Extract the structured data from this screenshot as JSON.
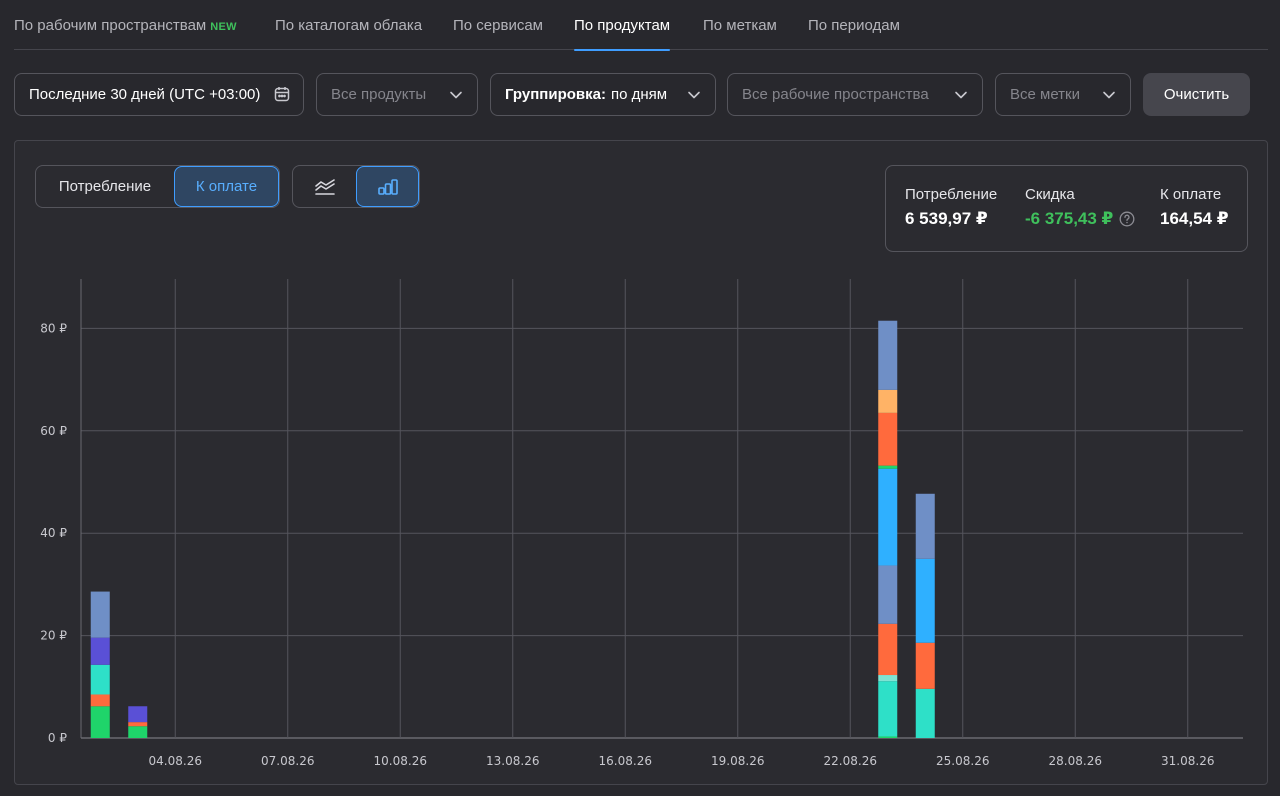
{
  "tabs": [
    {
      "label": "По рабочим пространствам",
      "badge": "NEW"
    },
    {
      "label": "По каталогам облака"
    },
    {
      "label": "По сервисам"
    },
    {
      "label": "По продуктам",
      "active": true
    },
    {
      "label": "По меткам"
    },
    {
      "label": "По периодам"
    }
  ],
  "filters": {
    "period": "Последние 30 дней (UTC +03:00)",
    "products_placeholder": "Все продукты",
    "grouping_label": "Группировка:",
    "grouping_value": "по дням",
    "workspaces_placeholder": "Все рабочие пространства",
    "labels_placeholder": "Все метки",
    "clear_label": "Очистить"
  },
  "mode": {
    "consumption_label": "Потребление",
    "payable_label": "К оплате",
    "selected": "К оплате",
    "chart_view": "bar"
  },
  "summary": {
    "consumption_label": "Потребление",
    "consumption_value": "6 539,97 ₽",
    "discount_label": "Скидка",
    "discount_value": "-6 375,43 ₽",
    "payable_label": "К оплате",
    "payable_value": "164,54 ₽"
  },
  "colors": {
    "accent": "#3f9dff",
    "discount": "#3fc05c",
    "series": [
      "#1fd46a",
      "#ff6a3d",
      "#2ee0c8",
      "#5a50d6",
      "#6f8fc6",
      "#2fb0ff",
      "#ffb366",
      "#7fe3d4"
    ]
  },
  "chart_data": {
    "type": "bar",
    "stacked": true,
    "x_tick_labels": [
      "04.08.26",
      "07.08.26",
      "10.08.26",
      "13.08.26",
      "16.08.26",
      "19.08.26",
      "22.08.26",
      "25.08.26",
      "28.08.26",
      "31.08.26"
    ],
    "y_tick_labels": [
      "0 ₽",
      "20 ₽",
      "40 ₽",
      "60 ₽",
      "80 ₽"
    ],
    "ylim": [
      0,
      90
    ],
    "grid": true,
    "bars": [
      {
        "date": "02.08.26",
        "segments": [
          {
            "color": "#1fd46a",
            "value": 6.2
          },
          {
            "color": "#ff6a3d",
            "value": 2.3
          },
          {
            "color": "#2ee0c8",
            "value": 5.8
          },
          {
            "color": "#5a50d6",
            "value": 5.3
          },
          {
            "color": "#6f8fc6",
            "value": 9.0
          }
        ]
      },
      {
        "date": "03.08.26",
        "segments": [
          {
            "color": "#1fd46a",
            "value": 2.3
          },
          {
            "color": "#ff6a3d",
            "value": 0.8
          },
          {
            "color": "#5a50d6",
            "value": 3.1
          }
        ]
      },
      {
        "date": "23.08.26",
        "segments": [
          {
            "color": "#1fd46a",
            "value": 0.3
          },
          {
            "color": "#2ee0c8",
            "value": 10.8
          },
          {
            "color": "#7fe3d4",
            "value": 1.2
          },
          {
            "color": "#ff6a3d",
            "value": 10.0
          },
          {
            "color": "#6f8fc6",
            "value": 11.4
          },
          {
            "color": "#2fb0ff",
            "value": 18.9
          },
          {
            "color": "#1fd46a",
            "value": 0.6
          },
          {
            "color": "#ff6a3d",
            "value": 10.3
          },
          {
            "color": "#ffb366",
            "value": 4.5
          },
          {
            "color": "#6f8fc6",
            "value": 13.5
          }
        ]
      },
      {
        "date": "24.08.26",
        "segments": [
          {
            "color": "#2ee0c8",
            "value": 9.6
          },
          {
            "color": "#ff6a3d",
            "value": 9.0
          },
          {
            "color": "#2fb0ff",
            "value": 16.4
          },
          {
            "color": "#6f8fc6",
            "value": 12.7
          }
        ]
      }
    ]
  }
}
